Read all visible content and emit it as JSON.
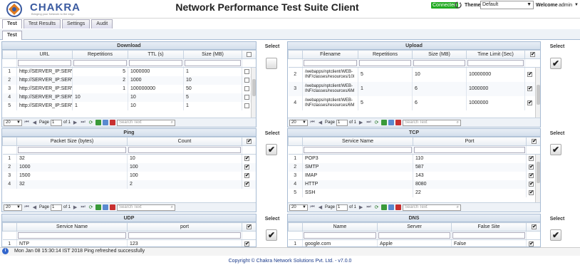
{
  "header": {
    "logo_text": "CHAKRA",
    "logo_tagline": "Bringing your Network to the edge",
    "title": "Network Performance Test Suite Client",
    "connection_status": "Connected",
    "theme_label": "Theme",
    "theme_value": "Default",
    "welcome_label": "Welcome",
    "username": "admin"
  },
  "main_tabs": [
    "Test",
    "Test Results",
    "Settings",
    "Audit"
  ],
  "sub_tabs": [
    "Test"
  ],
  "select_label": "Select",
  "pager": {
    "page_size": "20",
    "page_label": "Page",
    "page_value": "1",
    "of_label": "of 1",
    "search_placeholder": "Search Text"
  },
  "download": {
    "title": "Download",
    "columns": [
      "URL",
      "Repetitions",
      "TTL (s)",
      "Size (MB)"
    ],
    "rows": [
      [
        "1",
        "http://SERVER_IP:SERVE",
        "5",
        "1000000",
        "1"
      ],
      [
        "2",
        "http://SERVER_IP:SERVE",
        "2",
        "1000",
        "10"
      ],
      [
        "3",
        "http://SERVER_IP:SERVE",
        "1",
        "100000000",
        "50"
      ],
      [
        "4",
        "http://SERVER_IP:SERVE",
        "10",
        "10",
        "5"
      ],
      [
        "5",
        "http://SERVER_IP:SERVE",
        "1",
        "10",
        "1"
      ]
    ]
  },
  "upload": {
    "title": "Upload",
    "columns": [
      "Filename",
      "Repetitions",
      "Size (MB)",
      "Time Limit (Sec)"
    ],
    "rows": [
      [
        "2",
        "/webapps/nptclient/WEB-INF/classes/resources/10l",
        "5",
        "10",
        "10000000"
      ],
      [
        "3",
        "/webapps/nptclient/WEB-INF/classes/resources/6M",
        "1",
        "6",
        "1000000"
      ],
      [
        "4",
        "/webapps/nptclient/WEB-INF/classes/resources/6M",
        "5",
        "6",
        "1000000"
      ]
    ]
  },
  "ping": {
    "title": "Ping",
    "columns": [
      "Packet Size (bytes)",
      "Count"
    ],
    "rows": [
      [
        "1",
        "32",
        "10"
      ],
      [
        "2",
        "1000",
        "100"
      ],
      [
        "3",
        "1500",
        "100"
      ],
      [
        "4",
        "32",
        "2"
      ]
    ]
  },
  "tcp": {
    "title": "TCP",
    "columns": [
      "Service Name",
      "Port"
    ],
    "rows": [
      [
        "1",
        "POP3",
        "110"
      ],
      [
        "2",
        "SMTP",
        "587"
      ],
      [
        "3",
        "IMAP",
        "143"
      ],
      [
        "4",
        "HTTP",
        "8080"
      ],
      [
        "5",
        "SSH",
        "22"
      ]
    ]
  },
  "udp": {
    "title": "UDP",
    "columns": [
      "Service Name",
      "port"
    ],
    "rows": [
      [
        "1",
        "NTP",
        "123"
      ]
    ]
  },
  "dns": {
    "title": "DNS",
    "columns": [
      "Name",
      "Server",
      "False Site"
    ],
    "rows": [
      [
        "1",
        "google.com",
        "Apple",
        "False"
      ]
    ]
  },
  "status_bar": {
    "message": "Mon Jan 08 15:30:14 IST 2018 Ping refreshed successfully"
  },
  "footer": {
    "copyright": "Copyright © Chakra Network Solutions Pvt. Ltd. - v7.0.0"
  },
  "colors": {
    "accent": "#3a5aa0",
    "connected": "#22aa22",
    "panel_border": "#a8bcd4"
  }
}
